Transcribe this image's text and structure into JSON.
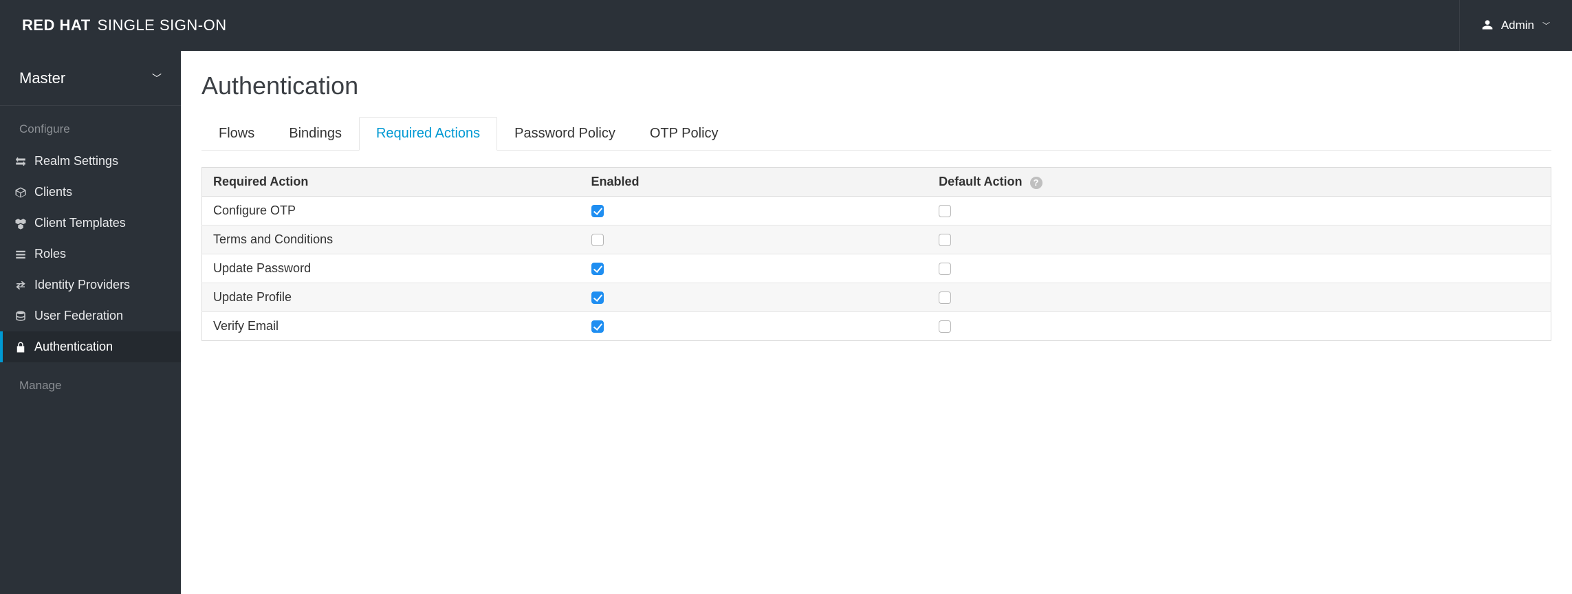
{
  "brand": {
    "bold": "RED HAT",
    "light": "SINGLE SIGN-ON"
  },
  "user": {
    "name": "Admin"
  },
  "realm": {
    "name": "Master"
  },
  "sidebar": {
    "section1_label": "Configure",
    "section2_label": "Manage",
    "items": [
      {
        "label": "Realm Settings"
      },
      {
        "label": "Clients"
      },
      {
        "label": "Client Templates"
      },
      {
        "label": "Roles"
      },
      {
        "label": "Identity Providers"
      },
      {
        "label": "User Federation"
      },
      {
        "label": "Authentication"
      }
    ]
  },
  "page": {
    "title": "Authentication"
  },
  "tabs": [
    {
      "label": "Flows"
    },
    {
      "label": "Bindings"
    },
    {
      "label": "Required Actions"
    },
    {
      "label": "Password Policy"
    },
    {
      "label": "OTP Policy"
    }
  ],
  "table": {
    "headers": {
      "c1": "Required Action",
      "c2": "Enabled",
      "c3": "Default Action"
    },
    "rows": [
      {
        "name": "Configure OTP",
        "enabled": true,
        "default": false
      },
      {
        "name": "Terms and Conditions",
        "enabled": false,
        "default": false
      },
      {
        "name": "Update Password",
        "enabled": true,
        "default": false
      },
      {
        "name": "Update Profile",
        "enabled": true,
        "default": false
      },
      {
        "name": "Verify Email",
        "enabled": true,
        "default": false
      }
    ]
  }
}
